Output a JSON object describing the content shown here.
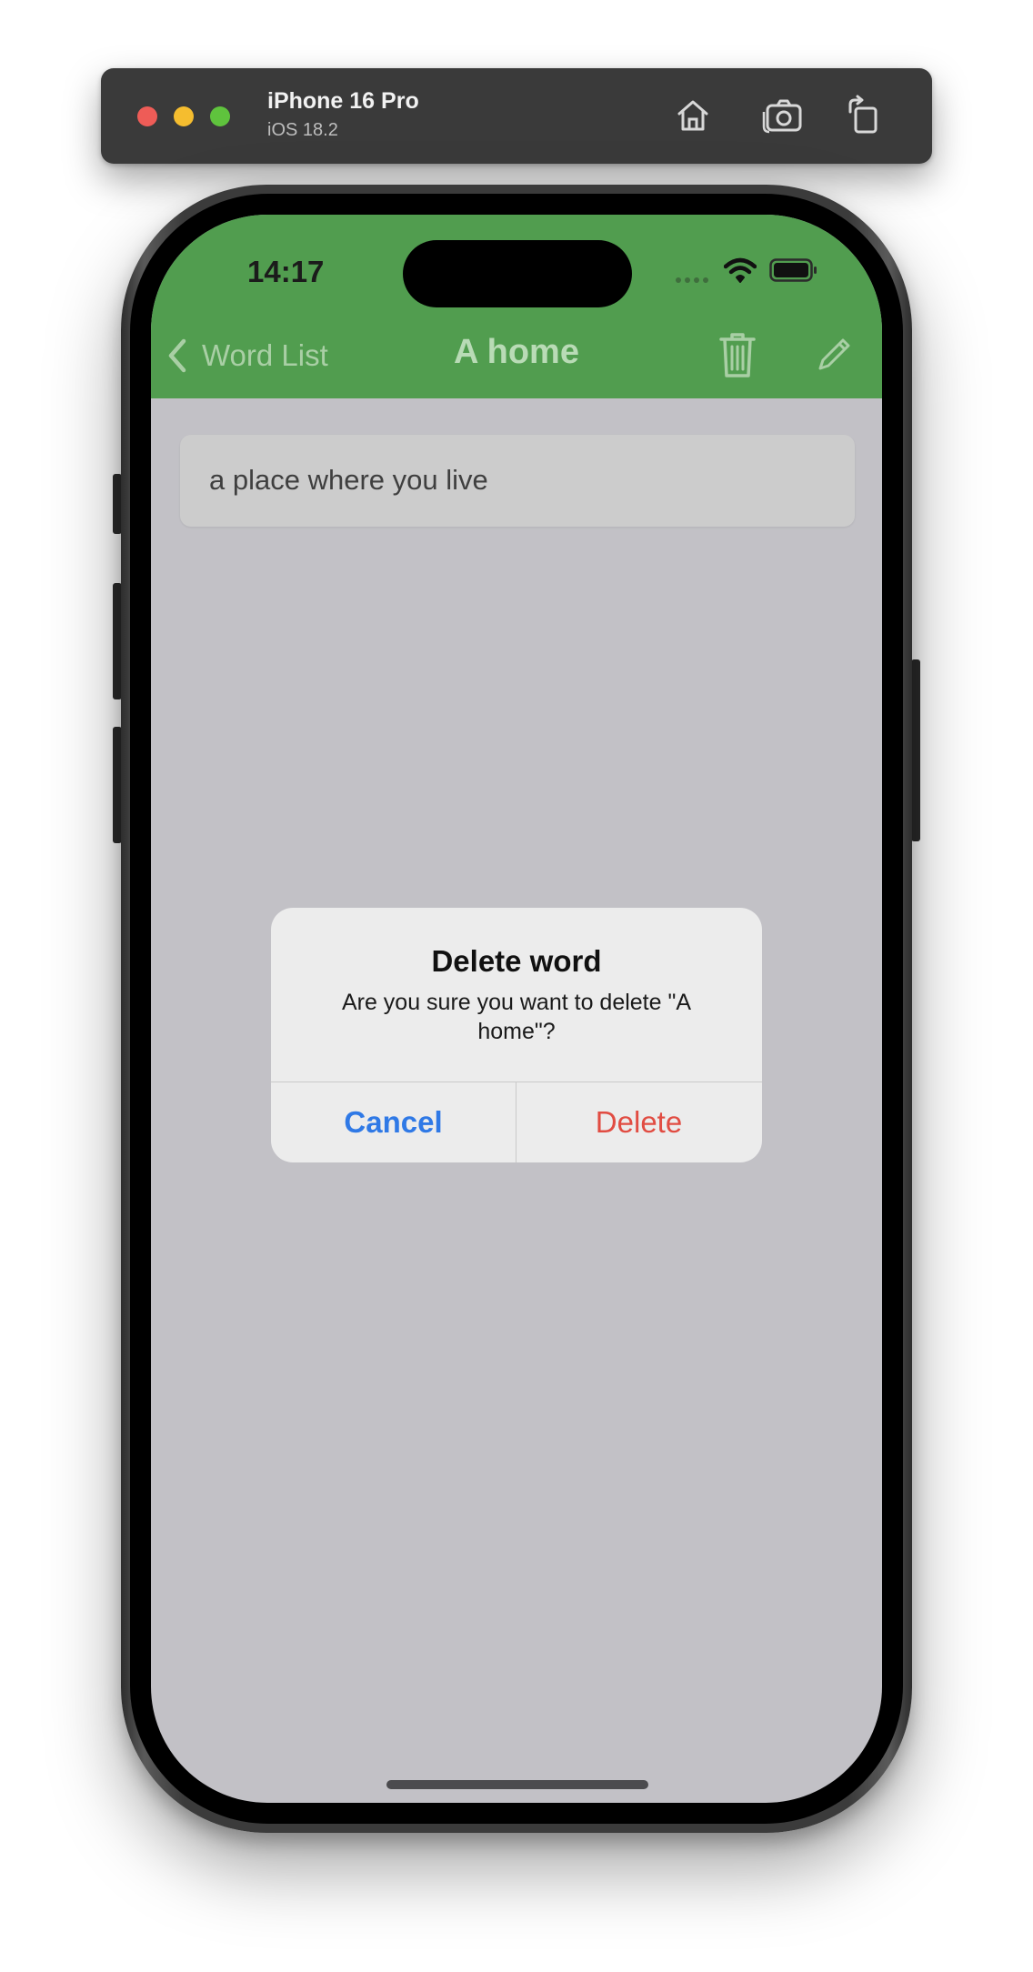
{
  "simulator": {
    "device_name": "iPhone 16 Pro",
    "os_version": "iOS 18.2",
    "icons": [
      "home-icon",
      "screenshot-icon",
      "rotate-icon"
    ]
  },
  "status_bar": {
    "time": "14:17"
  },
  "nav_bar": {
    "back_label": "Word List",
    "title": "A home",
    "colors": {
      "background": "#519d4f"
    }
  },
  "content": {
    "definition": "a place where you live"
  },
  "alert": {
    "title": "Delete word",
    "message": "Are you sure you want to delete \"A home\"?",
    "cancel_label": "Cancel",
    "delete_label": "Delete",
    "colors": {
      "cancel": "#2f79e6",
      "delete": "#e14c42"
    }
  }
}
